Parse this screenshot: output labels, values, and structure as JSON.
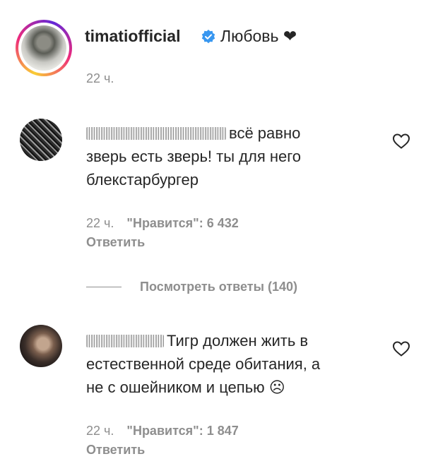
{
  "post": {
    "username": "timatiofficial",
    "caption": "Любовь ❤",
    "time": "22 ч.",
    "verified_icon": "verified-badge-icon",
    "accent_color": "#3897f0"
  },
  "comments": [
    {
      "text_line1": "всё равно",
      "text_line2": "зверь есть зверь! ты для него",
      "text_line3": "блекстарбургер",
      "time": "22 ч.",
      "likes": "\"Нравится\": 6 432",
      "reply_label": "Ответить",
      "like_icon": "heart-icon"
    },
    {
      "text_line1": "Тигр должен жить в",
      "text_line2": "естественной среде обитания, а",
      "text_line3": "не с ошейником и цепью ☹",
      "time": "22 ч.",
      "likes": "\"Нравится\": 1 847",
      "reply_label": "Ответить",
      "like_icon": "heart-icon"
    }
  ],
  "view_replies": "Посмотреть ответы (140)"
}
